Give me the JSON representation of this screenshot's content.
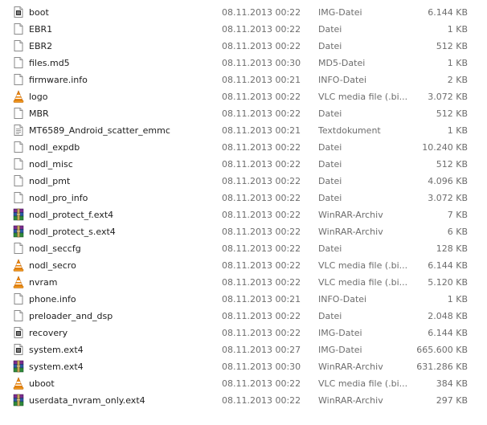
{
  "files": [
    {
      "name": "boot",
      "date": "08.11.2013 00:22",
      "type": "IMG-Datei",
      "size": "6.144 KB",
      "icon": "img-file-icon"
    },
    {
      "name": "EBR1",
      "date": "08.11.2013 00:22",
      "type": "Datei",
      "size": "1 KB",
      "icon": "blank-file-icon"
    },
    {
      "name": "EBR2",
      "date": "08.11.2013 00:22",
      "type": "Datei",
      "size": "512 KB",
      "icon": "blank-file-icon"
    },
    {
      "name": "files.md5",
      "date": "08.11.2013 00:30",
      "type": "MD5-Datei",
      "size": "1 KB",
      "icon": "blank-file-icon"
    },
    {
      "name": "firmware.info",
      "date": "08.11.2013 00:21",
      "type": "INFO-Datei",
      "size": "2 KB",
      "icon": "blank-file-icon"
    },
    {
      "name": "logo",
      "date": "08.11.2013 00:22",
      "type": "VLC media file (.bi...",
      "size": "3.072 KB",
      "icon": "vlc-icon"
    },
    {
      "name": "MBR",
      "date": "08.11.2013 00:22",
      "type": "Datei",
      "size": "512 KB",
      "icon": "blank-file-icon"
    },
    {
      "name": "MT6589_Android_scatter_emmc",
      "date": "08.11.2013 00:21",
      "type": "Textdokument",
      "size": "1 KB",
      "icon": "text-file-icon"
    },
    {
      "name": "nodl_expdb",
      "date": "08.11.2013 00:22",
      "type": "Datei",
      "size": "10.240 KB",
      "icon": "blank-file-icon"
    },
    {
      "name": "nodl_misc",
      "date": "08.11.2013 00:22",
      "type": "Datei",
      "size": "512 KB",
      "icon": "blank-file-icon"
    },
    {
      "name": "nodl_pmt",
      "date": "08.11.2013 00:22",
      "type": "Datei",
      "size": "4.096 KB",
      "icon": "blank-file-icon"
    },
    {
      "name": "nodl_pro_info",
      "date": "08.11.2013 00:22",
      "type": "Datei",
      "size": "3.072 KB",
      "icon": "blank-file-icon"
    },
    {
      "name": "nodl_protect_f.ext4",
      "date": "08.11.2013 00:22",
      "type": "WinRAR-Archiv",
      "size": "7 KB",
      "icon": "winrar-icon"
    },
    {
      "name": "nodl_protect_s.ext4",
      "date": "08.11.2013 00:22",
      "type": "WinRAR-Archiv",
      "size": "6 KB",
      "icon": "winrar-icon"
    },
    {
      "name": "nodl_seccfg",
      "date": "08.11.2013 00:22",
      "type": "Datei",
      "size": "128 KB",
      "icon": "blank-file-icon"
    },
    {
      "name": "nodl_secro",
      "date": "08.11.2013 00:22",
      "type": "VLC media file (.bi...",
      "size": "6.144 KB",
      "icon": "vlc-icon"
    },
    {
      "name": "nvram",
      "date": "08.11.2013 00:22",
      "type": "VLC media file (.bi...",
      "size": "5.120 KB",
      "icon": "vlc-icon"
    },
    {
      "name": "phone.info",
      "date": "08.11.2013 00:21",
      "type": "INFO-Datei",
      "size": "1 KB",
      "icon": "blank-file-icon"
    },
    {
      "name": "preloader_and_dsp",
      "date": "08.11.2013 00:22",
      "type": "Datei",
      "size": "2.048 KB",
      "icon": "blank-file-icon"
    },
    {
      "name": "recovery",
      "date": "08.11.2013 00:22",
      "type": "IMG-Datei",
      "size": "6.144 KB",
      "icon": "img-file-icon"
    },
    {
      "name": "system.ext4",
      "date": "08.11.2013 00:27",
      "type": "IMG-Datei",
      "size": "665.600 KB",
      "icon": "img-file-icon"
    },
    {
      "name": "system.ext4",
      "date": "08.11.2013 00:30",
      "type": "WinRAR-Archiv",
      "size": "631.286 KB",
      "icon": "winrar-icon"
    },
    {
      "name": "uboot",
      "date": "08.11.2013 00:22",
      "type": "VLC media file (.bi...",
      "size": "384 KB",
      "icon": "vlc-icon"
    },
    {
      "name": "userdata_nvram_only.ext4",
      "date": "08.11.2013 00:22",
      "type": "WinRAR-Archiv",
      "size": "297 KB",
      "icon": "winrar-icon"
    }
  ],
  "colors": {
    "name_text": "#1e1e1e",
    "detail_text": "#6d6d6d",
    "vlc_orange": "#f08a10",
    "winrar_purple": "#7b2c8e"
  }
}
